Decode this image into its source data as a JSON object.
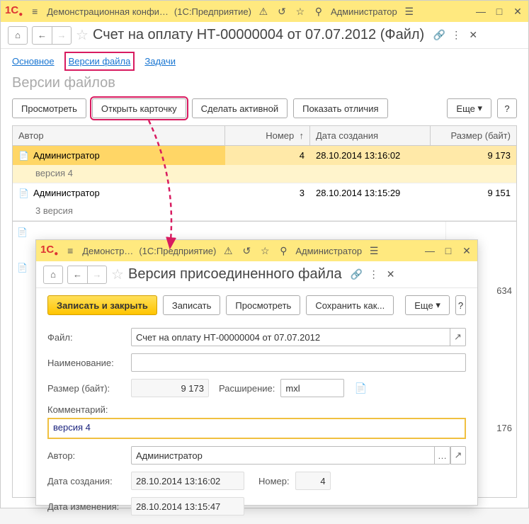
{
  "main": {
    "appTitle": "Демонстрационная конфи…",
    "appSuffix": "(1С:Предприятие)",
    "user": "Администратор",
    "pageTitle": "Счет на оплату НТ-00000004 от 07.07.2012 (Файл)",
    "tabs": {
      "main": "Основное",
      "versions": "Версии файла",
      "tasks": "Задачи"
    },
    "subheading": "Версии файлов",
    "buttons": {
      "view": "Просмотреть",
      "openCard": "Открыть карточку",
      "makeActive": "Сделать активной",
      "showDiff": "Показать отличия",
      "more": "Еще",
      "help": "?"
    },
    "columns": {
      "author": "Автор",
      "num": "Номер",
      "date": "Дата создания",
      "size": "Размер (байт)"
    },
    "rows": [
      {
        "author": "Администратор",
        "num": "4",
        "date": "28.10.2014 13:16:02",
        "size": "9 173",
        "sub": "версия 4",
        "sel": true
      },
      {
        "author": "Администратор",
        "num": "3",
        "date": "28.10.2014 13:15:29",
        "size": "9 151",
        "sub": "3 версия",
        "sel": false
      }
    ],
    "ghost": {
      "s1": "634",
      "s2": "176"
    }
  },
  "sub": {
    "appTitle": "Демонстр…",
    "appSuffix": "(1С:Предприятие)",
    "user": "Администратор",
    "pageTitle": "Версия присоединенного файла",
    "buttons": {
      "saveClose": "Записать и закрыть",
      "save": "Записать",
      "view": "Просмотреть",
      "saveAs": "Сохранить как...",
      "more": "Еще",
      "help": "?"
    },
    "labels": {
      "file": "Файл:",
      "name": "Наименование:",
      "size": "Размер (байт):",
      "ext": "Расширение:",
      "comment": "Комментарий:",
      "author": "Автор:",
      "created": "Дата создания:",
      "num": "Номер:",
      "modified": "Дата изменения:"
    },
    "values": {
      "file": "Счет на оплату НТ-00000004 от 07.07.2012",
      "name": "",
      "size": "9 173",
      "ext": "mxl",
      "comment": "версия 4",
      "author": "Администратор",
      "created": "28.10.2014 13:16:02",
      "num": "4",
      "modified": "28.10.2014 13:15:47"
    }
  }
}
